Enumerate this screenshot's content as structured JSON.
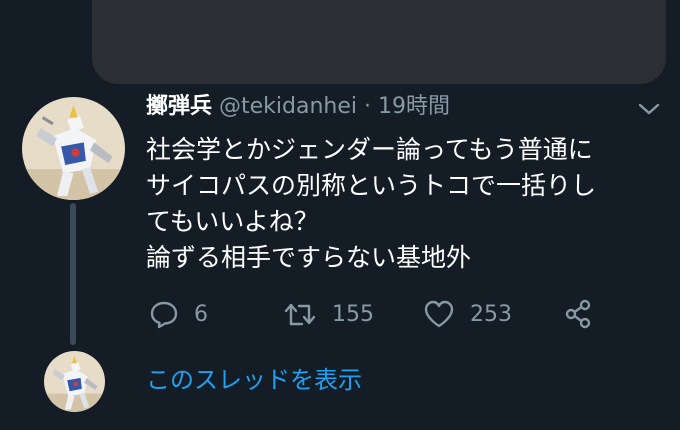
{
  "tweet": {
    "display_name": "擲弾兵",
    "handle": "@tekidanhei",
    "separator": "·",
    "time": "19時間",
    "lines": [
      "社会学とかジェンダー論ってもう普通に",
      "サイコパスの別称というトコで一括りし",
      "てもいいよね？",
      "論ずる相手ですらない基地外"
    ],
    "replies": "6",
    "retweets": "155",
    "likes": "253"
  },
  "thread": {
    "show_label": "このスレッドを表示"
  },
  "icons": {
    "reply": "speech-bubble-icon",
    "retweet": "retweet-icon",
    "like": "heart-icon",
    "share": "share-icon",
    "menu": "chevron-down-icon"
  },
  "colors": {
    "background": "#141d26",
    "muted": "#8899a6",
    "link": "#1da1f2",
    "text": "#ffffff"
  }
}
